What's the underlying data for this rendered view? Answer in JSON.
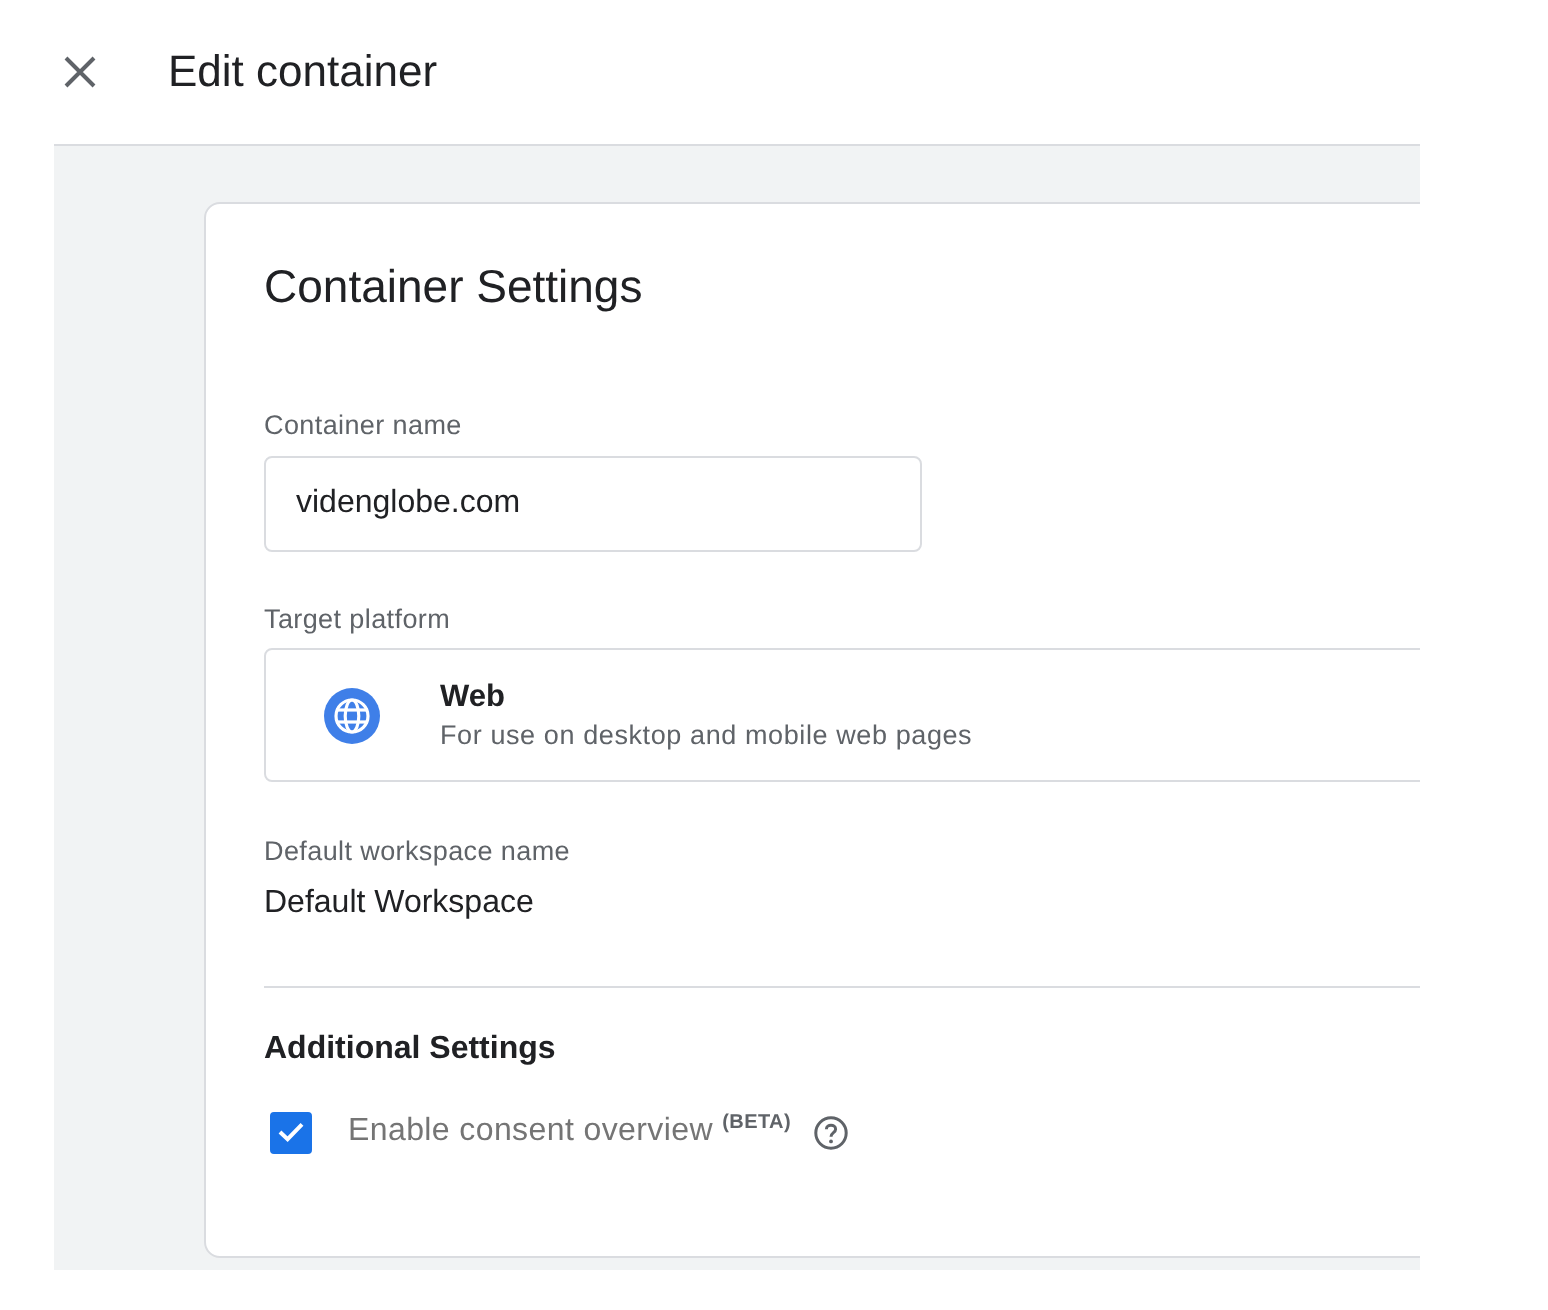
{
  "header": {
    "title": "Edit container"
  },
  "card": {
    "title": "Container Settings",
    "container_name": {
      "label": "Container name",
      "value": "videnglobe.com"
    },
    "target_platform": {
      "label": "Target platform",
      "options": [
        {
          "kind": "web",
          "name": "Web",
          "description": "For use on desktop and mobile web pages"
        }
      ]
    },
    "default_workspace": {
      "label": "Default workspace name",
      "value": "Default Workspace"
    },
    "additional_settings": {
      "title": "Additional Settings",
      "options": [
        {
          "label": "Enable consent overview $^{(BETA)}$",
          "checked": true
        }
      ]
    }
  }
}
